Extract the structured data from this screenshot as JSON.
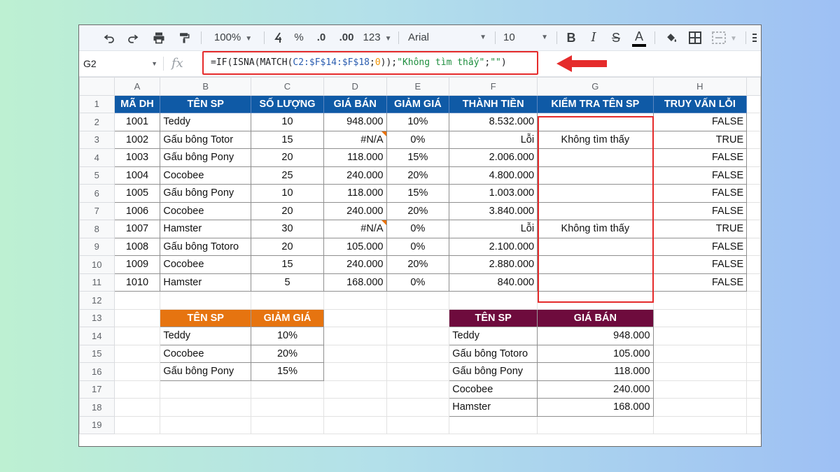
{
  "toolbar": {
    "zoom": "100%",
    "percent_label": "%",
    "decrease_decimal_label": ".0",
    "increase_decimal_label": ".00",
    "number_format_label": "123",
    "font_family": "Arial",
    "font_size": "10",
    "bold_label": "B",
    "italic_label": "I",
    "strike_label": "S",
    "text_color_label": "A"
  },
  "formula_bar": {
    "cell_ref": "G2",
    "fx_label": "fx",
    "formula": {
      "part1": "=IF(ISNA(MATCH(",
      "ref": "C2:$F$14:$F$18",
      "part2": ";",
      "num": "0",
      "part3": "));",
      "str1": "\"Không tìm thấy\"",
      "part4": ";",
      "str2": "\"\"",
      "part5": ")"
    }
  },
  "columns": [
    "A",
    "B",
    "C",
    "D",
    "E",
    "F",
    "G",
    "H"
  ],
  "rows": [
    "1",
    "2",
    "3",
    "4",
    "5",
    "6",
    "7",
    "8",
    "9",
    "10",
    "11",
    "12",
    "13",
    "14",
    "15",
    "16",
    "17",
    "18",
    "19"
  ],
  "table_main": {
    "headers": [
      "MÃ DH",
      "TÊN SP",
      "SỐ LƯỢNG",
      "GIÁ BÁN",
      "GIẢM GIÁ",
      "THÀNH TIỀN",
      "KIỂM TRA TÊN SP",
      "TRUY VẤN LỖI"
    ],
    "rows": [
      [
        "1001",
        "Teddy",
        "10",
        "948.000",
        "10%",
        "8.532.000",
        "",
        "FALSE"
      ],
      [
        "1002",
        "Gấu bông Totor",
        "15",
        "#N/A",
        "0%",
        "Lỗi",
        "Không tìm thấy",
        "TRUE"
      ],
      [
        "1003",
        "Gấu bông Pony",
        "20",
        "118.000",
        "15%",
        "2.006.000",
        "",
        "FALSE"
      ],
      [
        "1004",
        "Cocobee",
        "25",
        "240.000",
        "20%",
        "4.800.000",
        "",
        "FALSE"
      ],
      [
        "1005",
        "Gấu bông Pony",
        "10",
        "118.000",
        "15%",
        "1.003.000",
        "",
        "FALSE"
      ],
      [
        "1006",
        "Cocobee",
        "20",
        "240.000",
        "20%",
        "3.840.000",
        "",
        "FALSE"
      ],
      [
        "1007",
        "Hamster",
        "30",
        "#N/A",
        "0%",
        "Lỗi",
        "Không tìm thấy",
        "TRUE"
      ],
      [
        "1008",
        "Gấu bông Totoro",
        "20",
        "105.000",
        "0%",
        "2.100.000",
        "",
        "FALSE"
      ],
      [
        "1009",
        "Cocobee",
        "15",
        "240.000",
        "20%",
        "2.880.000",
        "",
        "FALSE"
      ],
      [
        "1010",
        "Hamster",
        "5",
        "168.000",
        "0%",
        "840.000",
        "",
        "FALSE"
      ]
    ]
  },
  "table_discount": {
    "headers": [
      "TÊN SP",
      "GIẢM GIÁ"
    ],
    "rows": [
      [
        "Teddy",
        "10%"
      ],
      [
        "Cocobee",
        "20%"
      ],
      [
        "Gấu bông Pony",
        "15%"
      ]
    ]
  },
  "table_price": {
    "headers": [
      "TÊN SP",
      "GIÁ BÁN"
    ],
    "rows": [
      [
        "Teddy",
        "948.000"
      ],
      [
        "Gấu bông Totoro",
        "105.000"
      ],
      [
        "Gấu bông Pony",
        "118.000"
      ],
      [
        "Cocobee",
        "240.000"
      ],
      [
        "Hamster",
        "168.000"
      ]
    ]
  },
  "colors": {
    "main_header": "#0f5aa6",
    "discount_header": "#e67410",
    "price_header": "#6e0b3d",
    "highlight": "#e52b2b"
  }
}
